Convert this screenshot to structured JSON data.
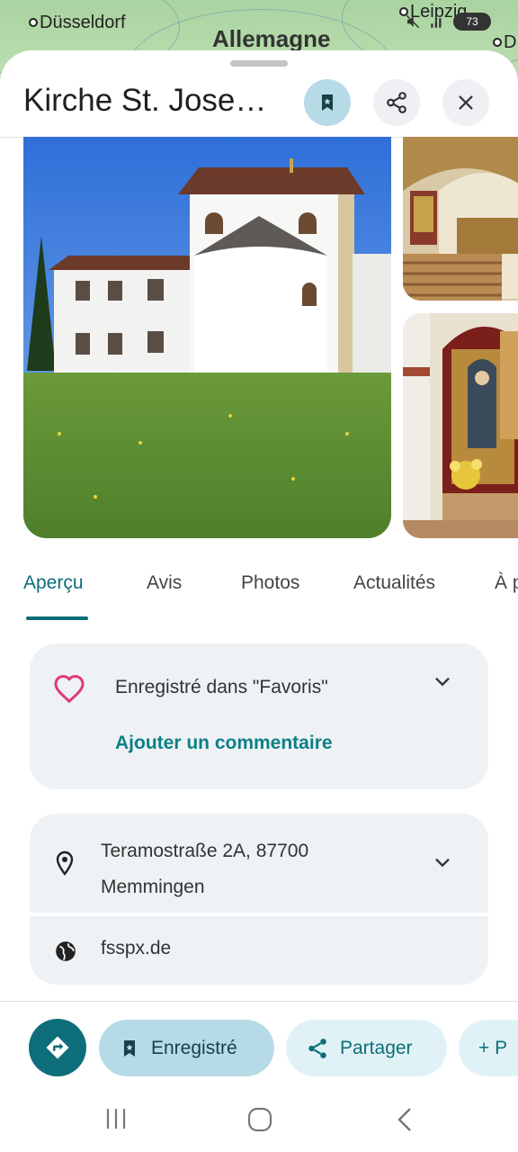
{
  "map": {
    "labels": [
      "Düsseldorf",
      "Allemagne",
      "Leipzig",
      "D"
    ]
  },
  "status_bar": {
    "battery": "73"
  },
  "sheet": {
    "title": "Kirche St. Jose…"
  },
  "header_buttons": {
    "save_icon": "bookmark-icon",
    "share_icon": "share-icon",
    "close_icon": "close-icon"
  },
  "tabs": [
    {
      "label": "Aperçu",
      "active": true
    },
    {
      "label": "Avis",
      "active": false
    },
    {
      "label": "Photos",
      "active": false
    },
    {
      "label": "Actualités",
      "active": false
    },
    {
      "label": "À p",
      "active": false
    }
  ],
  "favorite_card": {
    "icon": "heart-icon",
    "text": "Enregistré dans \"Favoris\"",
    "link": "Ajouter un commentaire"
  },
  "address_card": {
    "line1": "Teramostraße 2A, 87700",
    "line2": "Memmingen"
  },
  "website_card": {
    "url": "fsspx.de"
  },
  "actions": {
    "saved_label": "Enregistré",
    "share_label": "Partager",
    "more_label": "+ P"
  },
  "colors": {
    "accent": "#0d6e7a",
    "chip_saved": "#b7dbe6",
    "chip_light": "#e1f2f6",
    "heart": "#e0397d"
  }
}
